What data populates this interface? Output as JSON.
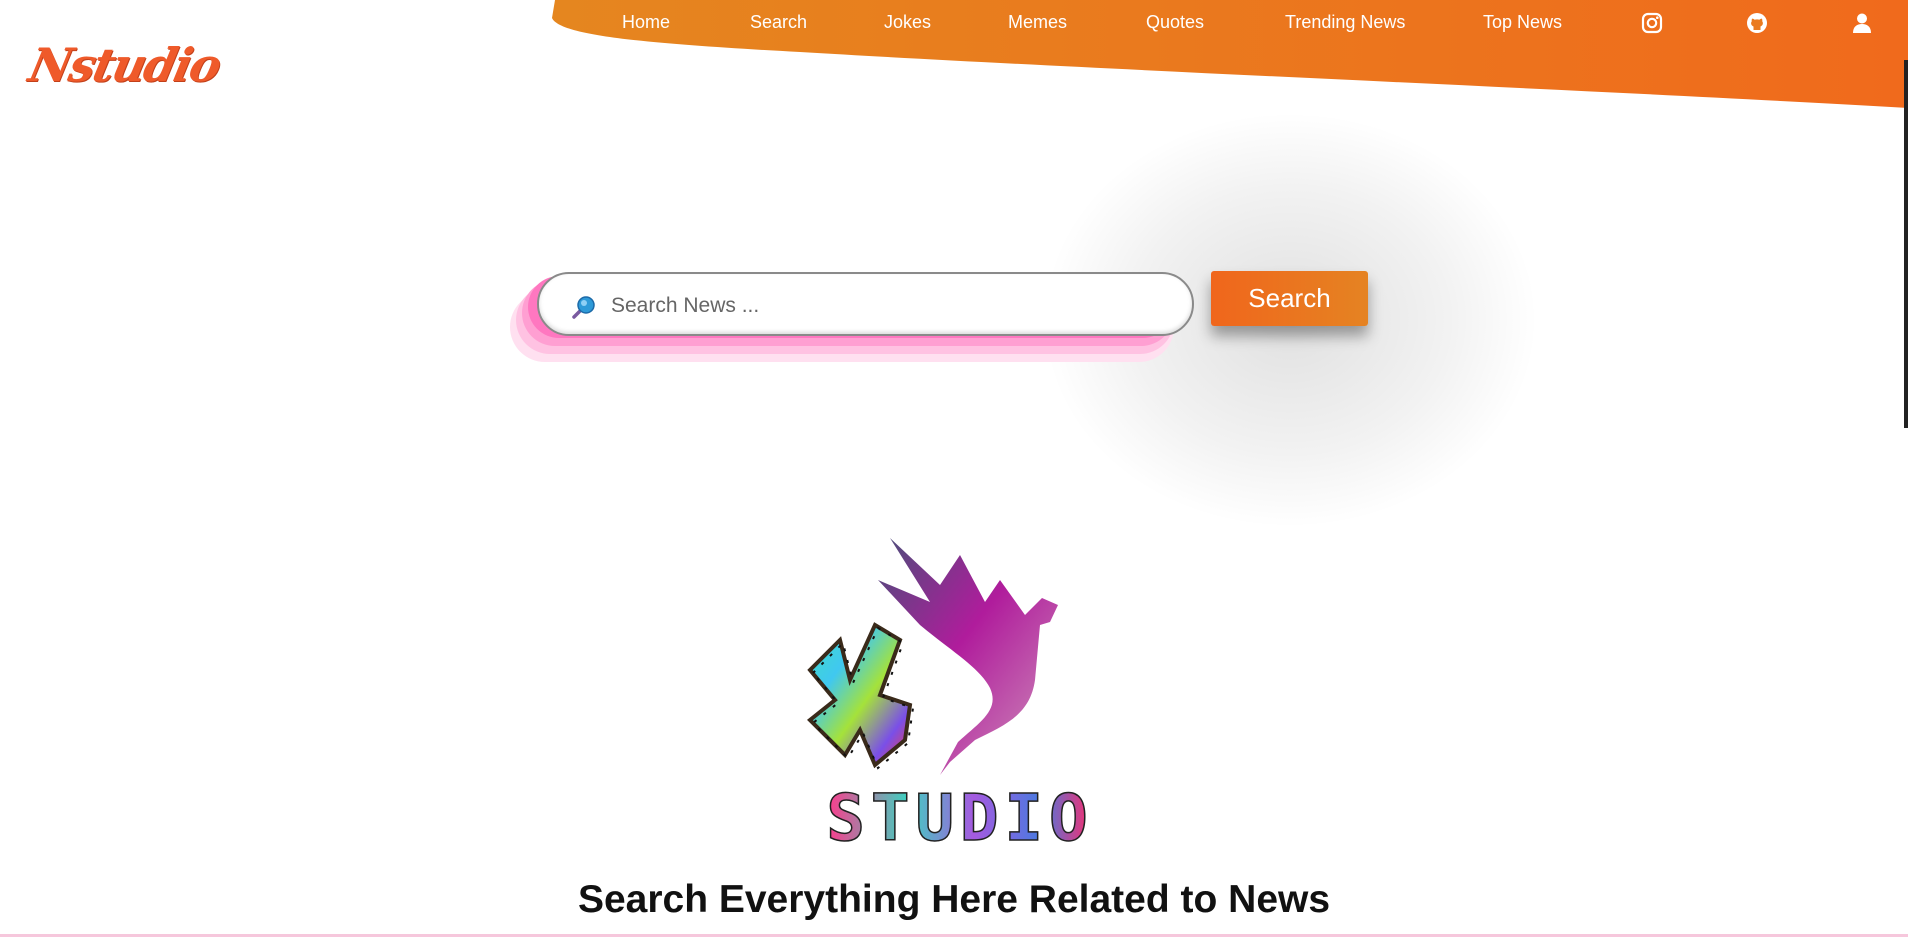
{
  "brand": {
    "logo_text": "Nstudio"
  },
  "nav": {
    "items": [
      "Home",
      "Search",
      "Jokes",
      "Memes",
      "Quotes",
      "Trending News",
      "Top News"
    ],
    "icons": [
      "instagram-icon",
      "github-icon",
      "user-icon"
    ]
  },
  "search": {
    "placeholder": "Search News ...",
    "value": "",
    "button_label": "Search"
  },
  "logo_art": {
    "wordmark": "STUDIO"
  },
  "tagline": "Search Everything Here Related to News",
  "colors": {
    "accent_orange": "#f0661c",
    "header_orange": "#e88a1c",
    "brand_red": "#ef5a2a",
    "pink_shadow": "#ff77c0"
  }
}
